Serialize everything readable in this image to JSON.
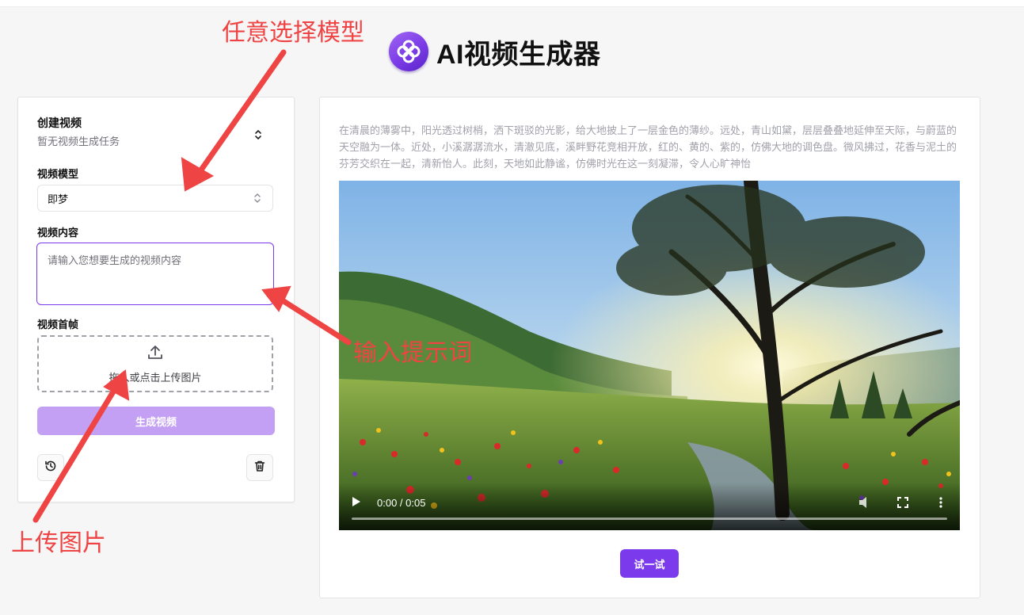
{
  "header": {
    "title": "AI视频生成器"
  },
  "sidebar": {
    "title": "创建视频",
    "subtitle": "暂无视频生成任务",
    "model_label": "视频模型",
    "model_value": "即梦",
    "content_label": "视频内容",
    "content_placeholder": "请输入您想要生成的视频内容",
    "first_frame_label": "视频首帧",
    "upload_text": "拖入或点击上传图片",
    "generate_label": "生成视频"
  },
  "main": {
    "description": "在清晨的薄雾中，阳光透过树梢，洒下斑驳的光影，给大地披上了一层金色的薄纱。远处，青山如黛，层层叠叠地延伸至天际，与蔚蓝的天空融为一体。近处，小溪潺潺流水，清澈见底，溪畔野花竞相开放，红的、黄的、紫的，仿佛大地的调色盘。微风拂过，花香与泥土的芬芳交织在一起，清新怡人。此刻，天地如此静谧，仿佛时光在这一刻凝滞，令人心旷神怡",
    "video": {
      "time": "0:00 / 0:05",
      "progress": 0
    },
    "try_label": "试一试"
  },
  "annotations": {
    "model": "任意选择模型",
    "prompt": "输入提示词",
    "upload": "上传图片"
  },
  "colors": {
    "accent": "#7c3aed",
    "accent_light": "#c4a0f5",
    "annotation": "#ef4444"
  },
  "icons": [
    "app-logo-icon",
    "chevron-updown-icon",
    "upload-icon",
    "history-icon",
    "trash-icon",
    "play-icon",
    "volume-icon",
    "fullscreen-icon",
    "more-icon"
  ]
}
